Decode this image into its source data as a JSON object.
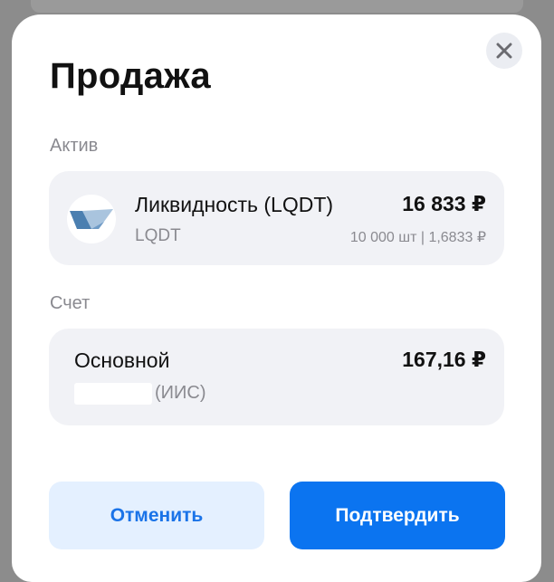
{
  "dialog": {
    "title": "Продажа",
    "close_icon": "close-icon"
  },
  "asset": {
    "section_label": "Актив",
    "name": "Ликвидность (LQDT)",
    "ticker": "LQDT",
    "value": "16 833 ₽",
    "details": "10 000 шт | 1,6833 ₽",
    "logo_icon": "lqdt-logo-icon"
  },
  "account": {
    "section_label": "Счет",
    "name": "Основной",
    "type": "(ИИС)",
    "balance": "167,16 ₽"
  },
  "actions": {
    "cancel_label": "Отменить",
    "confirm_label": "Подтвердить"
  },
  "colors": {
    "accent": "#0b74f0",
    "accent_light": "#e4f0ff",
    "card_bg": "#f1f2f6",
    "muted_text": "#8a8a90"
  }
}
